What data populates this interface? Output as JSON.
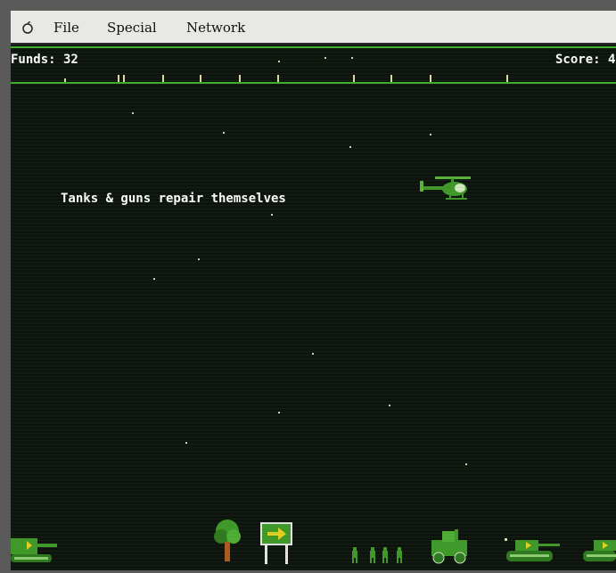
{
  "menubar": {
    "apple_icon": "apple-icon",
    "items": [
      "File",
      "Special",
      "Network"
    ]
  },
  "hud": {
    "funds": "Funds: 32",
    "score": "Score: 4"
  },
  "message": "Tanks & guns repair themselves",
  "colors": {
    "screen_bg": "#0d140d",
    "hud_line": "#3fae2a",
    "unit_green": "#3f9a2a",
    "text": "#ffffff"
  },
  "units": [
    "helicopter",
    "player-tank",
    "tree",
    "arrow-sign",
    "infantry",
    "jeep",
    "enemy-tank",
    "enemy-tank"
  ]
}
